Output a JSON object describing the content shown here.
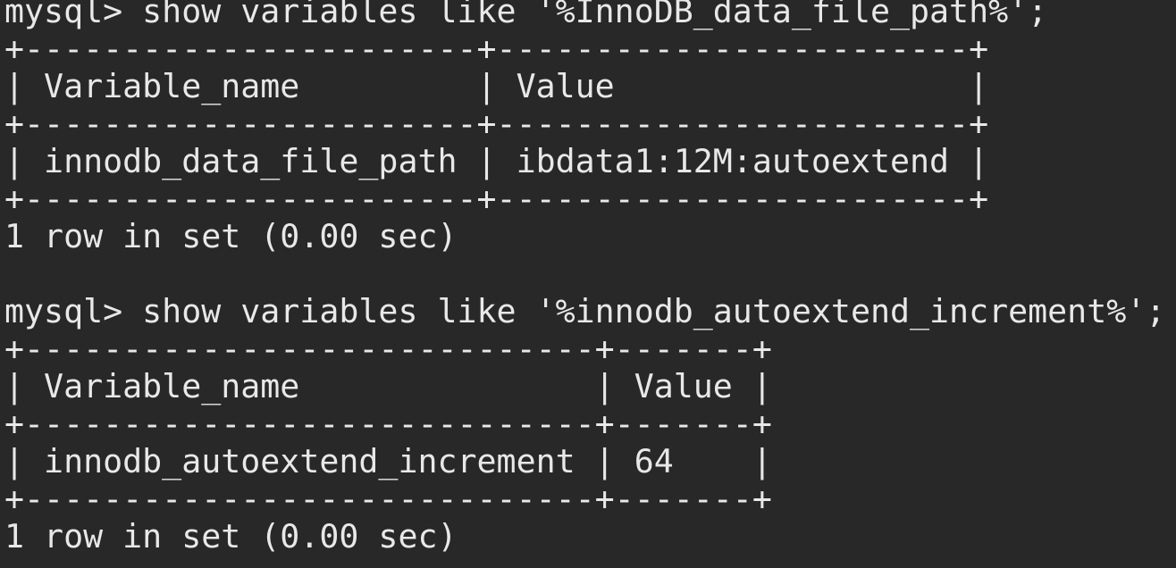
{
  "terminal": {
    "lines": [
      "mysql> show variables like '%InnoDB_data_file_path%';",
      "+-----------------------+------------------------+",
      "| Variable_name         | Value                  |",
      "+-----------------------+------------------------+",
      "| innodb_data_file_path | ibdata1:12M:autoextend |",
      "+-----------------------+------------------------+",
      "1 row in set (0.00 sec)",
      "",
      "mysql> show variables like '%innodb_autoextend_increment%';",
      "+-----------------------------+-------+",
      "| Variable_name               | Value |",
      "+-----------------------------+-------+",
      "| innodb_autoextend_increment | 64    |",
      "+-----------------------------+-------+",
      "1 row in set (0.00 sec)"
    ]
  },
  "colors": {
    "background": "#282828",
    "text": "#e8e8e8"
  }
}
